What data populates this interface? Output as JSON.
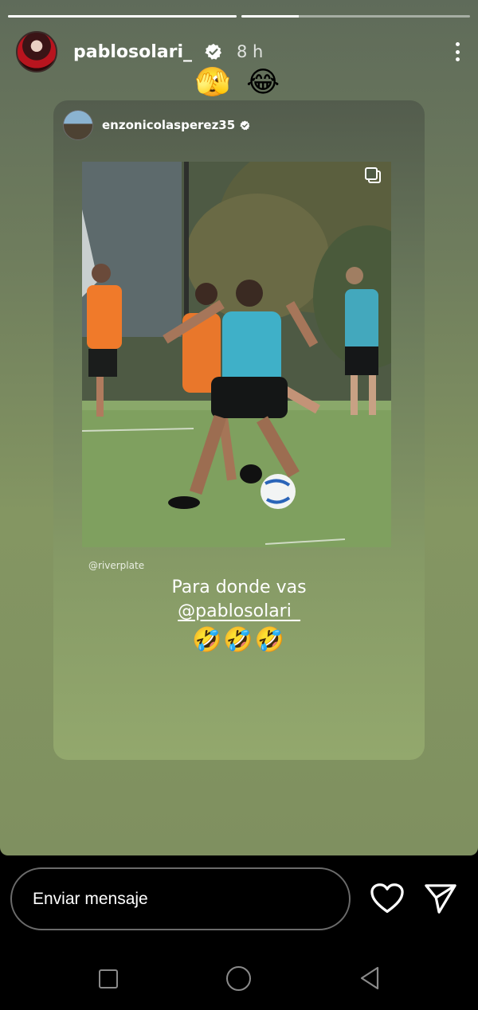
{
  "story": {
    "progress": [
      1.0,
      0.25
    ],
    "username": "pablosolari_",
    "time": "8 h",
    "top_emojis": "🫣 😂"
  },
  "shared_post": {
    "username": "enzonicolasperez35",
    "credit": "@riverplate",
    "caption_line1": "Para donde vas",
    "caption_mention": "@pablosolari_",
    "caption_emojis": "🤣🤣🤣"
  },
  "reply": {
    "placeholder": "Enviar mensaje"
  },
  "icons": {
    "verified": "verified-badge-icon",
    "more": "more-vertical-icon",
    "heart": "heart-icon",
    "send": "send-icon",
    "multi_photo": "multi-photo-icon"
  },
  "colors": {
    "verified_badge": "#ffffff",
    "story_bg_top": "#5f6b5a",
    "story_bg_bottom": "#7f9060"
  }
}
